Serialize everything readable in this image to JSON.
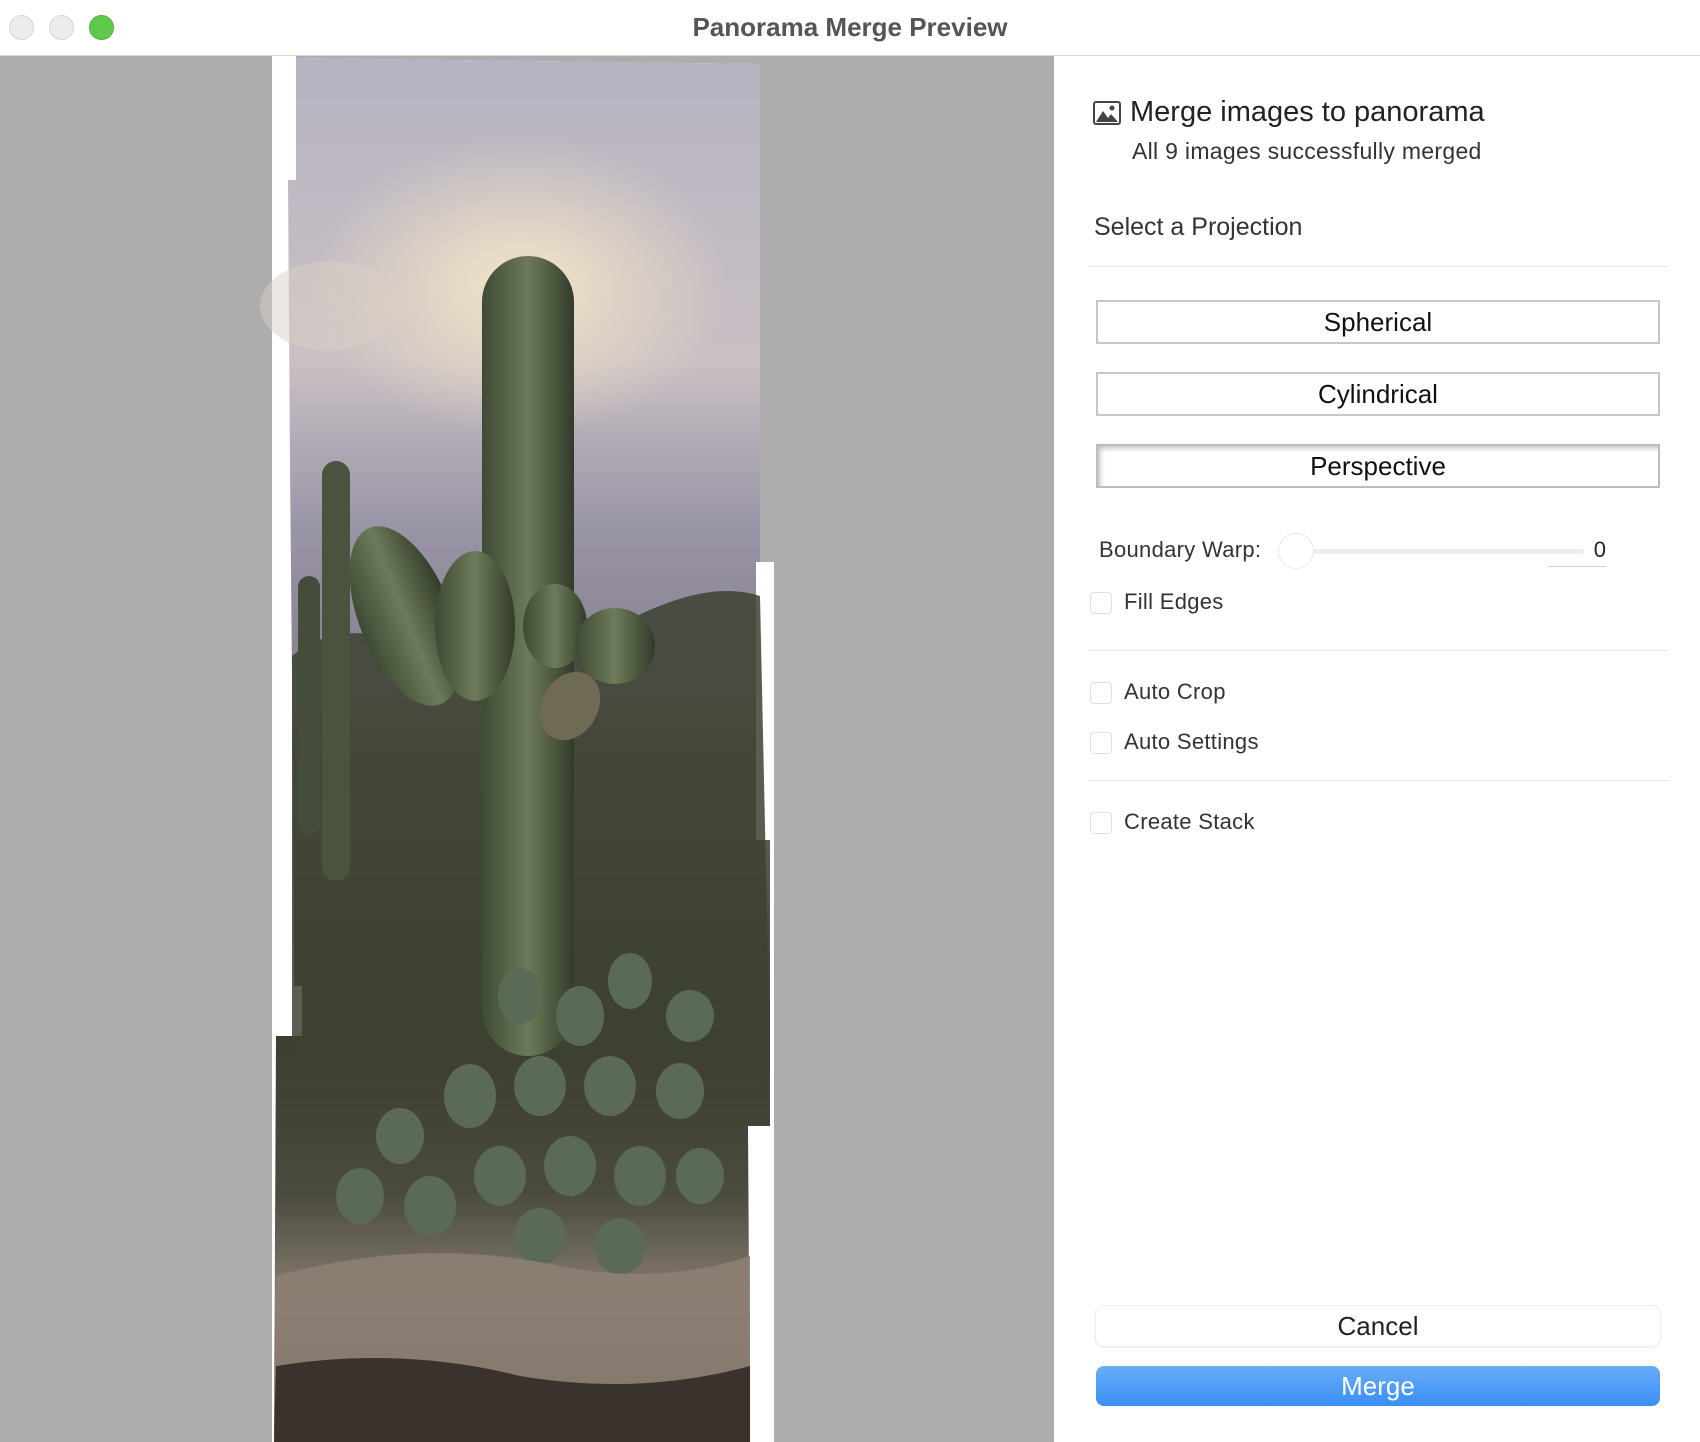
{
  "window": {
    "title": "Panorama Merge Preview",
    "controls": [
      "close",
      "minimize",
      "zoom"
    ]
  },
  "preview": {
    "content": "panorama-photo-icon"
  },
  "panel": {
    "header": {
      "icon": "image-icon",
      "title": "Merge images to panorama",
      "subtitle": "All 9 images successfully merged"
    },
    "projection": {
      "label": "Select a Projection",
      "options": [
        "Spherical",
        "Cylindrical",
        "Perspective"
      ],
      "selected": "Perspective"
    },
    "boundary_warp": {
      "label": "Boundary Warp:",
      "value": "0"
    },
    "checkboxes": {
      "fill_edges": {
        "label": "Fill Edges",
        "checked": false
      },
      "auto_crop": {
        "label": "Auto Crop",
        "checked": false
      },
      "auto_settings": {
        "label": "Auto Settings",
        "checked": false
      },
      "create_stack": {
        "label": "Create Stack",
        "checked": false
      }
    },
    "buttons": {
      "cancel": "Cancel",
      "merge": "Merge"
    }
  },
  "colors": {
    "preview_background": "#adadad",
    "accent": "#3a8ef5",
    "zoom_button": "#5fc94b"
  }
}
